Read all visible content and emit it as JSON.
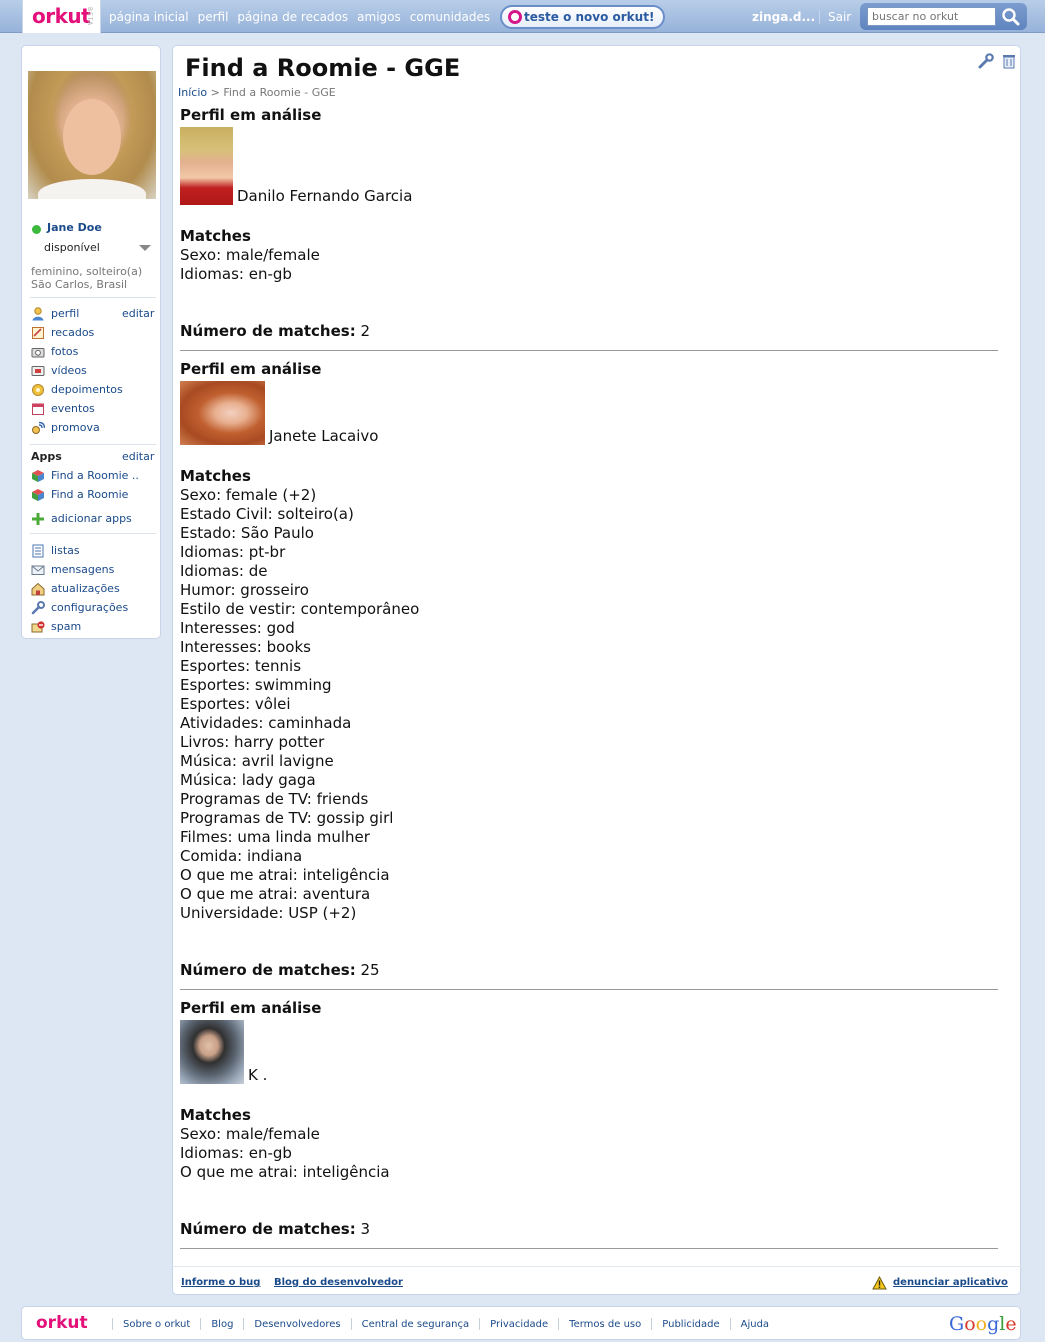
{
  "topbar": {
    "logo": "orkut",
    "logo_beta": "BETA",
    "nav": [
      "página inicial",
      "perfil",
      "página de recados",
      "amigos",
      "comunidades"
    ],
    "try_new": "teste o novo orkut!",
    "user_short": "zinga.d...",
    "logout": "Sair",
    "search_placeholder": "buscar no orkut"
  },
  "sidebar": {
    "user_name": "Jane Doe",
    "status": "disponível",
    "info_line1": "feminino, solteiro(a)",
    "info_line2": "São Carlos, Brasil",
    "edit": "editar",
    "menu": [
      {
        "label": "perfil",
        "icon": "profile-icon"
      },
      {
        "label": "recados",
        "icon": "scrap-icon"
      },
      {
        "label": "fotos",
        "icon": "camera-icon"
      },
      {
        "label": "vídeos",
        "icon": "video-icon"
      },
      {
        "label": "depoimentos",
        "icon": "testimonial-icon"
      },
      {
        "label": "eventos",
        "icon": "calendar-icon"
      },
      {
        "label": "promova",
        "icon": "promote-icon"
      }
    ],
    "apps_title": "Apps",
    "apps": [
      {
        "label": "Find a Roomie ..",
        "icon": "app-cube-icon"
      },
      {
        "label": "Find a Roomie",
        "icon": "app-cube-icon"
      }
    ],
    "add_apps": "adicionar apps",
    "menu2": [
      {
        "label": "listas",
        "icon": "list-icon"
      },
      {
        "label": "mensagens",
        "icon": "mail-icon"
      },
      {
        "label": "atualizações",
        "icon": "updates-icon"
      },
      {
        "label": "configurações",
        "icon": "wrench-icon"
      },
      {
        "label": "spam",
        "icon": "spam-icon"
      }
    ]
  },
  "main": {
    "title": "Find a Roomie - GGE",
    "breadcrumb_home": "Início",
    "breadcrumb_sep": ">",
    "breadcrumb_current": "Find a Roomie - GGE",
    "profile_heading": "Perfil em análise",
    "matches_heading": "Matches",
    "count_label": "Número de matches:",
    "profiles": [
      {
        "name": "Danilo Fernando Garcia",
        "matches": [
          "Sexo: male/female",
          "Idiomas: en-gb"
        ],
        "count": "2"
      },
      {
        "name": "Janete Lacaivo",
        "matches": [
          "Sexo: female (+2)",
          "Estado Civil: solteiro(a)",
          "Estado: São Paulo",
          "Idiomas: pt-br",
          "Idiomas: de",
          "Humor: grosseiro",
          "Estilo de vestir: contemporâneo",
          "Interesses: god",
          "Interesses: books",
          "Esportes: tennis",
          "Esportes: swimming",
          "Esportes: vôlei",
          "Atividades: caminhada",
          "Livros: harry potter",
          "Música: avril lavigne",
          "Música: lady gaga",
          "Programas de TV: friends",
          "Programas de TV: gossip girl",
          "Filmes: uma linda mulher",
          "Comida: indiana",
          "O que me atrai: inteligência",
          "O que me atrai: aventura",
          "Universidade: USP (+2)"
        ],
        "count": "25"
      },
      {
        "name": "K .",
        "matches": [
          "Sexo: male/female",
          "Idiomas: en-gb",
          "O que me atrai: inteligência"
        ],
        "count": "3"
      }
    ],
    "report_bug": "Informe o bug",
    "dev_blog": "Blog do desenvolvedor",
    "report_app": "denunciar aplicativo"
  },
  "footer": {
    "logo": "orkut",
    "links": [
      "Sobre o orkut",
      "Blog",
      "Desenvolvedores",
      "Central de segurança",
      "Privacidade",
      "Termos de uso",
      "Publicidade",
      "Ajuda"
    ],
    "google": "Google"
  }
}
